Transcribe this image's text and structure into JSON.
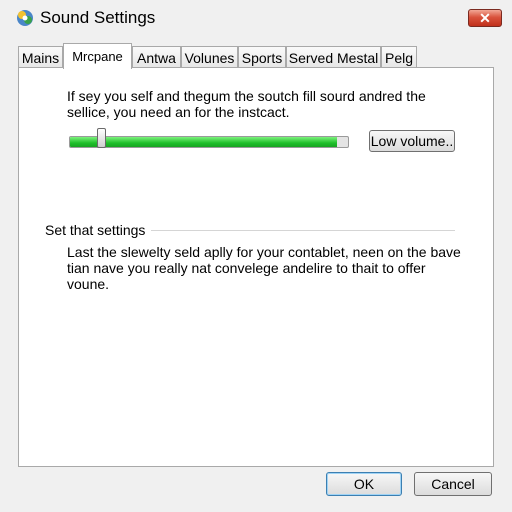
{
  "window": {
    "title": "Sound Settings",
    "icon": "sound-settings-app-icon",
    "close_icon": "close-icon"
  },
  "tabs": [
    {
      "label": "Mains",
      "active": false
    },
    {
      "label": "Mrcpane",
      "active": true
    },
    {
      "label": "Antwa",
      "active": false
    },
    {
      "label": "Volunes",
      "active": false
    },
    {
      "label": "Sports",
      "active": false
    },
    {
      "label": "Served Mestal",
      "active": false
    },
    {
      "label": "Pelg",
      "active": false
    }
  ],
  "panel": {
    "description": "If sey you self and thegum the soutch fill sourd andred the sellice, you need an for the instcact.",
    "slider": {
      "level_fraction": 0.96,
      "thumb_fraction": 0.1,
      "fill_color": "#22c02c"
    },
    "low_volume_label": "Low volume..",
    "section_label": "Set that settings",
    "section_text": "Last the slewelty seld aplly for your contablet, neen on the bave tian nave you really nat convelege andelire to thait to offer voune."
  },
  "footer": {
    "ok_label": "OK",
    "cancel_label": "Cancel"
  }
}
